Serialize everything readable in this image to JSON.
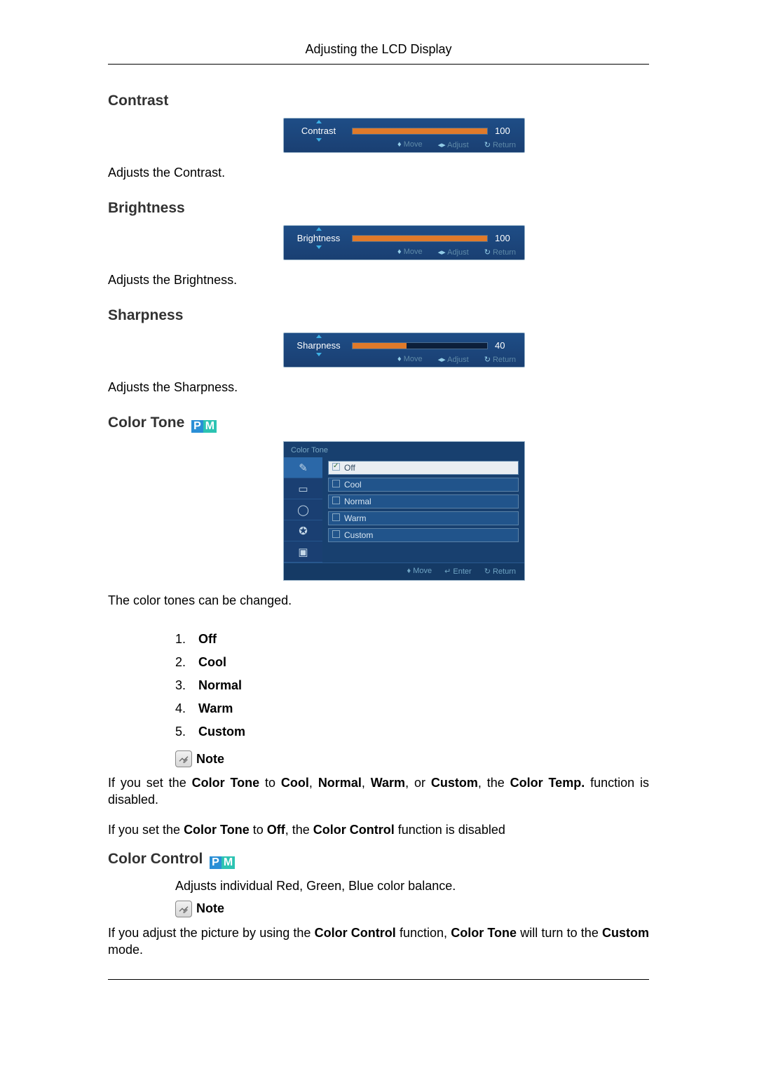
{
  "header": {
    "title": "Adjusting the LCD Display"
  },
  "contrast": {
    "title": "Contrast",
    "osd_label": "Contrast",
    "value": "100",
    "fill_pct": "100%",
    "desc": "Adjusts the Contrast."
  },
  "brightness": {
    "title": "Brightness",
    "osd_label": "Brightness",
    "value": "100",
    "fill_pct": "100%",
    "desc": "Adjusts the Brightness."
  },
  "sharpness": {
    "title": "Sharpness",
    "osd_label": "Sharpness",
    "value": "40",
    "fill_pct": "40%",
    "desc": "Adjusts the Sharpness."
  },
  "slider_hints": {
    "move": "Move",
    "adjust": "Adjust",
    "ret": "Return"
  },
  "color_tone": {
    "title": "Color Tone",
    "menu_title": "Color Tone",
    "options": {
      "off": "Off",
      "cool": "Cool",
      "normal": "Normal",
      "warm": "Warm",
      "custom": "Custom"
    },
    "hints": {
      "move": "Move",
      "enter": "Enter",
      "ret": "Return"
    },
    "desc": "The color tones can be changed.",
    "list": {
      "n1": "1.",
      "l1": "Off",
      "n2": "2.",
      "l2": "Cool",
      "n3": "3.",
      "l3": "Normal",
      "n4": "4.",
      "l4": "Warm",
      "n5": "5.",
      "l5": "Custom"
    },
    "note_label": "Note",
    "note1": "If you set the Color Tone to Cool, Normal, Warm, or Custom, the Color Temp. function is disabled.",
    "note2": "If you set the Color Tone to Off, the Color Control function is disabled"
  },
  "color_control": {
    "title": "Color Control",
    "desc": "Adjusts individual Red, Green, Blue color balance.",
    "note_label": "Note",
    "note": "If you adjust the picture by using the Color Control function, Color Tone will turn to the Custom mode."
  },
  "pm_badge": {
    "p": "P",
    "m": "M"
  }
}
